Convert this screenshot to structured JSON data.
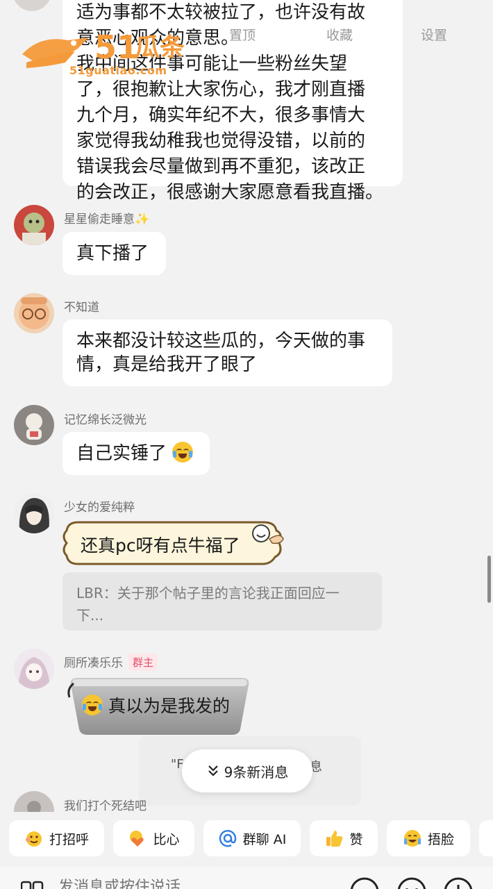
{
  "watermark": {
    "logo_text": "51瓜条",
    "url": "51guatiao.com",
    "menu": [
      "",
      "置顶",
      "收藏",
      "设置"
    ]
  },
  "top_message": {
    "lines": [
      "适为事都不太较被拉了，也许没有故",
      "意恶心观众的意思。",
      "我中间这件事可能让一些粉丝失望",
      "了，很抱歉让大家伤心，我才刚直播",
      "九个月，确实年纪不大，很多事情大",
      "家觉得我幼稚我也觉得没错，以前的",
      "错误我会尽量做到再不重犯，该改正",
      "的会改正，很感谢大家愿意看我直播。"
    ]
  },
  "messages": [
    {
      "nick": "星星偷走睡意✨",
      "text": "真下播了"
    },
    {
      "nick": "不知道",
      "lines": [
        "本来都没计较这些瓜的，今天做的事",
        "情，真是给我开了眼了"
      ]
    },
    {
      "nick": "记忆绵长泛微光",
      "text": "自己实锤了"
    },
    {
      "nick": "少女的爱纯粹",
      "text": "还真pc呀有点牛福了",
      "quote": [
        "LBR：关于那个帖子里的言论我正面回应一",
        "下..."
      ]
    },
    {
      "nick": "厕所凑乐乐",
      "tag": "群主",
      "text": "真以为是我发的"
    },
    {
      "nick": "我们打个死结吧"
    }
  ],
  "hidden_preview": "\"F",
  "hidden_preview_tail": "息",
  "new_messages_label": "9条新消息",
  "quick_actions": [
    {
      "label": "打招呼",
      "icon": "wave-emoji-icon"
    },
    {
      "label": "比心",
      "icon": "heart-hands-emoji-icon"
    },
    {
      "label": "群聊 AI",
      "icon": "at-icon"
    },
    {
      "label": "赞",
      "icon": "thumbs-up-icon"
    },
    {
      "label": "捂脸",
      "icon": "facepalm-emoji-icon"
    }
  ],
  "input": {
    "placeholder": "发消息或按住说话"
  },
  "colors": {
    "background": "#f2f2f2",
    "bubble": "#ffffff",
    "owner_tag": "#e0506a",
    "watermark": "#f49a3a"
  }
}
